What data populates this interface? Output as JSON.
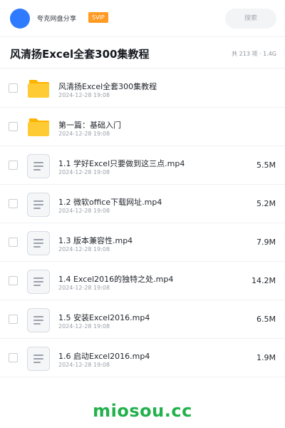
{
  "header": {
    "username": "夸克网盘分享",
    "badge": "SVIP",
    "search_placeholder": "搜索"
  },
  "titlebar": {
    "title": "风清扬Excel全套300集教程",
    "meta": "共 213 项 · 1.4G"
  },
  "items": [
    {
      "type": "folder",
      "name": "风清扬Excel全套300集教程",
      "date": "2024-12-28 19:08",
      "size": ""
    },
    {
      "type": "folder",
      "name": "第一篇：基础入门",
      "date": "2024-12-28 19:08",
      "size": ""
    },
    {
      "type": "file",
      "name": "1.1 学好Excel只要做到这三点.mp4",
      "date": "2024-12-28 19:08",
      "size": "5.5M"
    },
    {
      "type": "file",
      "name": "1.2 微软office下载网址.mp4",
      "date": "2024-12-28 19:08",
      "size": "5.2M"
    },
    {
      "type": "file",
      "name": "1.3 版本兼容性.mp4",
      "date": "2024-12-28 19:08",
      "size": "7.9M"
    },
    {
      "type": "file",
      "name": "1.4 Excel2016的独特之处.mp4",
      "date": "2024-12-28 19:08",
      "size": "14.2M"
    },
    {
      "type": "file",
      "name": "1.5 安装Excel2016.mp4",
      "date": "2024-12-28 19:08",
      "size": "6.5M"
    },
    {
      "type": "file",
      "name": "1.6 启动Excel2016.mp4",
      "date": "2024-12-28 19:08",
      "size": "1.9M"
    }
  ],
  "watermark": "miosou.cc",
  "colors": {
    "avatar": "#2f7bff",
    "badge": "#ff9a23",
    "folder": "#ffc933",
    "watermark": "#22b14c"
  },
  "icons": {
    "folder": "folder-icon",
    "file": "document-icon"
  }
}
